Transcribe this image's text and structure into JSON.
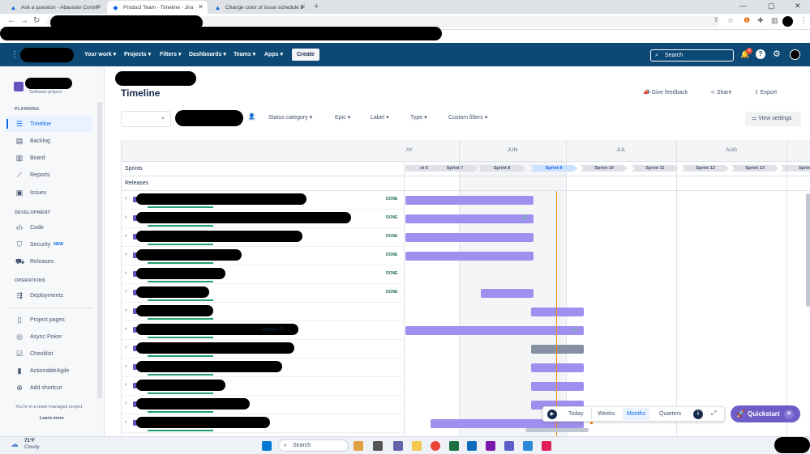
{
  "browser": {
    "tabs": [
      {
        "title": "Ask a question - Atlassian Comm",
        "active": false
      },
      {
        "title": "Product Team - Timeline - Jira",
        "active": true
      },
      {
        "title": "Change color of issue schedule b",
        "active": false
      }
    ]
  },
  "topnav": {
    "your_work": "Your work",
    "projects": "Projects",
    "filters": "Filters",
    "dashboards": "Dashboards",
    "teams": "Teams",
    "apps": "Apps",
    "create": "Create",
    "search_placeholder": "Search",
    "notification_count": "4"
  },
  "sidebar": {
    "project_type": "Software project",
    "planning_label": "PLANNING",
    "planning": [
      "Timeline",
      "Backlog",
      "Board",
      "Reports",
      "Issues"
    ],
    "development_label": "DEVELOPMENT",
    "development": [
      "Code",
      "Security",
      "Releases"
    ],
    "security_badge": "NEW",
    "operations_label": "OPERATIONS",
    "operations": [
      "Deployments"
    ],
    "extra": [
      "Project pages",
      "Async Poker",
      "Checklist",
      "ActionableAgile",
      "Add shortcut"
    ],
    "footer_text": "You're in a team-managed project",
    "learn_more": "Learn more"
  },
  "main": {
    "title": "Timeline",
    "give_feedback": "Give feedback",
    "share": "Share",
    "export": "Export",
    "filters": [
      "Status category",
      "Epic",
      "Label",
      "Type",
      "Custom filters"
    ],
    "view_settings": "View settings"
  },
  "timeline": {
    "sprints_label": "Sprints",
    "releases_label": "Releases",
    "months": [
      "AY",
      "JUN",
      "JUL",
      "AUG"
    ],
    "sprints": [
      "nt 6",
      "Sprint 7",
      "Sprint 8",
      "Sprint 9",
      "Sprint 10",
      "Sprint 11",
      "Sprint 12",
      "Sprint 13",
      "Sprin"
    ],
    "current_sprint": "Sprint 9",
    "rows": [
      {
        "status": "DONE"
      },
      {
        "status": "DONE"
      },
      {
        "status": "DONE"
      },
      {
        "status": "DONE"
      },
      {
        "status": "DONE"
      },
      {
        "status": "DONE"
      },
      {
        "status": ""
      },
      {
        "status": "",
        "visible_text": "search (f"
      },
      {
        "status": ""
      },
      {
        "status": ""
      },
      {
        "status": ""
      },
      {
        "status": ""
      },
      {
        "status": ""
      }
    ],
    "zoom": {
      "today": "Today",
      "weeks": "Weeks",
      "months": "Months",
      "quarters": "Quarters",
      "selected": "Months"
    },
    "quickstart": "Quickstart"
  },
  "taskbar": {
    "weather_temp": "71°F",
    "weather_desc": "Cloudy",
    "search": "Search"
  },
  "colors": {
    "nav": "#0c4a75",
    "bar": "#9f8fef",
    "today_line": "#f18d13",
    "done": "#216e4e",
    "quickstart": "#6e5dc6"
  }
}
